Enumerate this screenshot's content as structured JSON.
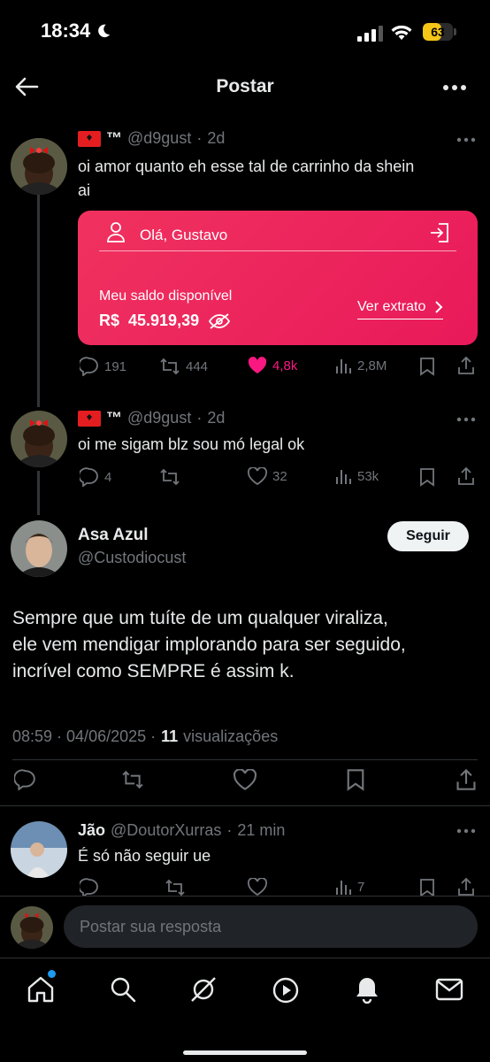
{
  "status_bar": {
    "time": "18:34",
    "battery": "63",
    "battery_level": 0.63
  },
  "header": {
    "title": "Postar"
  },
  "thread": [
    {
      "flag_name": "™",
      "handle": "@d9gust",
      "time": "2d",
      "text_line1": "oi amor quanto eh esse tal de carrinho da shein",
      "text_line2": "ai",
      "card": {
        "greeting": "Olá, Gustavo",
        "balance_label": "Meu saldo disponível",
        "currency": "R$",
        "balance": "45.919,39",
        "statement_link": "Ver extrato"
      },
      "replies": "191",
      "reposts": "444",
      "likes": "4,8k",
      "views": "2,8M"
    },
    {
      "flag_name": "™",
      "handle": "@d9gust",
      "time": "2d",
      "text": "oi me sigam blz sou mó legal ok",
      "replies": "4",
      "reposts": "",
      "likes": "32",
      "views": "53k"
    }
  ],
  "main_post": {
    "name": "Asa Azul",
    "handle": "@Custodiocust",
    "follow_label": "Seguir",
    "text_line1": "Sempre que um tuíte de um qualquer viraliza,",
    "text_line2": "ele vem mendigar implorando para ser seguido,",
    "text_line3": "incrível como SEMPRE é assim k.",
    "timestamp": "08:59 · 04/06/2025 ·",
    "views_count": "11",
    "views_label": "visualizações"
  },
  "reply": {
    "name": "Jão",
    "handle": "@DoutorXurras",
    "time": "21 min",
    "text": "É só não seguir ue",
    "views": "7"
  },
  "composer": {
    "placeholder": "Postar sua resposta"
  },
  "colors": {
    "accent_like": "#f91880",
    "card_pink": "#ee2a5e"
  }
}
